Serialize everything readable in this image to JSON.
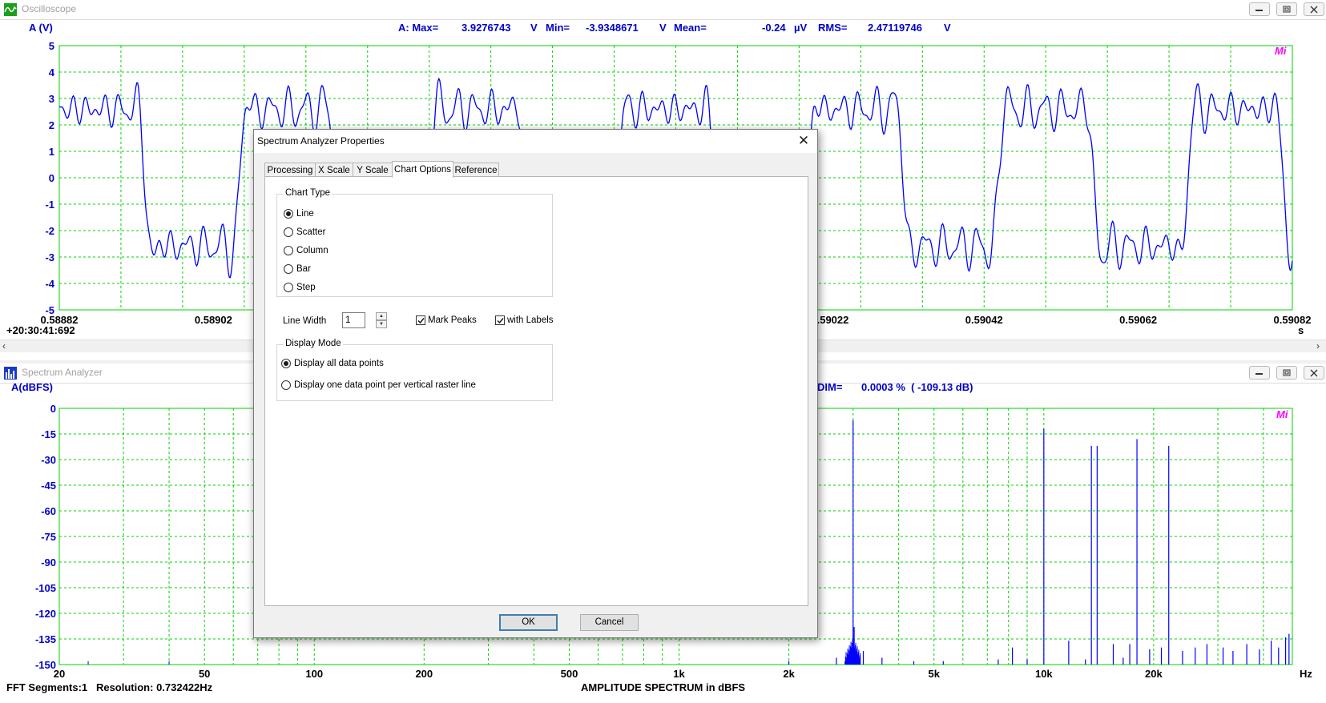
{
  "oscilloscope": {
    "title": "Oscilloscope",
    "y_unit_label": "A (V)",
    "stats": {
      "max_label": "A: Max=",
      "max_value": "3.9276743",
      "max_unit": "V",
      "min_label": "Min=",
      "min_value": "-3.9348671",
      "min_unit": "V",
      "mean_label": "Mean=",
      "mean_value": "-0.24",
      "mean_unit": "µV",
      "rms_label": "RMS=",
      "rms_value": "2.47119746",
      "rms_unit": "V"
    },
    "y_ticks": [
      "5",
      "4",
      "3",
      "2",
      "1",
      "0",
      "-1",
      "-2",
      "-3",
      "-4",
      "-5"
    ],
    "x_ticks": [
      "0.58882",
      "0.58902",
      "",
      "",
      "",
      "0.59022",
      "0.59042",
      "0.59062",
      "0.59082"
    ],
    "x_unit": "s",
    "timestamp": "+20:30:41:692",
    "mi_mark": "Mi"
  },
  "spectrum": {
    "title": "Spectrum Analyzer",
    "y_unit_label": "A(dBFS)",
    "dim_label": "DIM=",
    "dim_value": "0.0003 %  ( -109.13 dB)",
    "y_ticks": [
      "0",
      "-15",
      "-30",
      "-45",
      "-60",
      "-75",
      "-90",
      "-105",
      "-120",
      "-135",
      "-150"
    ],
    "x_ticks": [
      "20",
      "50",
      "100",
      "200",
      "500",
      "1k",
      "2k",
      "5k",
      "10k",
      "20k"
    ],
    "x_unit": "Hz",
    "footer_left": "FFT Segments:1   Resolution: 0.732422Hz",
    "footer_center": "AMPLITUDE SPECTRUM in dBFS",
    "mi_mark": "Mi"
  },
  "dialog": {
    "title": "Spectrum Analyzer Properties",
    "close_glyph": "✕",
    "tabs": [
      "Processing",
      "X Scale",
      "Y Scale",
      "Chart Options",
      "Reference"
    ],
    "active_tab": "Chart Options",
    "chart_type": {
      "label": "Chart Type",
      "options": [
        "Line",
        "Scatter",
        "Column",
        "Bar",
        "Step"
      ],
      "selected": "Line"
    },
    "line_width": {
      "label": "Line Width",
      "value": "1"
    },
    "mark_peaks": {
      "label": "Mark Peaks",
      "checked": true
    },
    "with_labels": {
      "label": "with Labels",
      "checked": true
    },
    "display_mode": {
      "label": "Display Mode",
      "options": [
        "Display all data points",
        "Display one data point per vertical raster line"
      ],
      "selected": "Display all data points"
    },
    "ok_label": "OK",
    "cancel_label": "Cancel"
  },
  "colors": {
    "grid": "#00d400",
    "trace": "#0000ff",
    "axis_text": "#0000cc",
    "mi": "#ff00ff",
    "dialog_default_border": "#3c7fb1"
  },
  "icons": [
    "oscilloscope-app-icon",
    "spectrum-app-icon",
    "minimize-icon",
    "restore-icon",
    "close-icon",
    "scroll-left-icon",
    "scroll-right-icon"
  ]
}
